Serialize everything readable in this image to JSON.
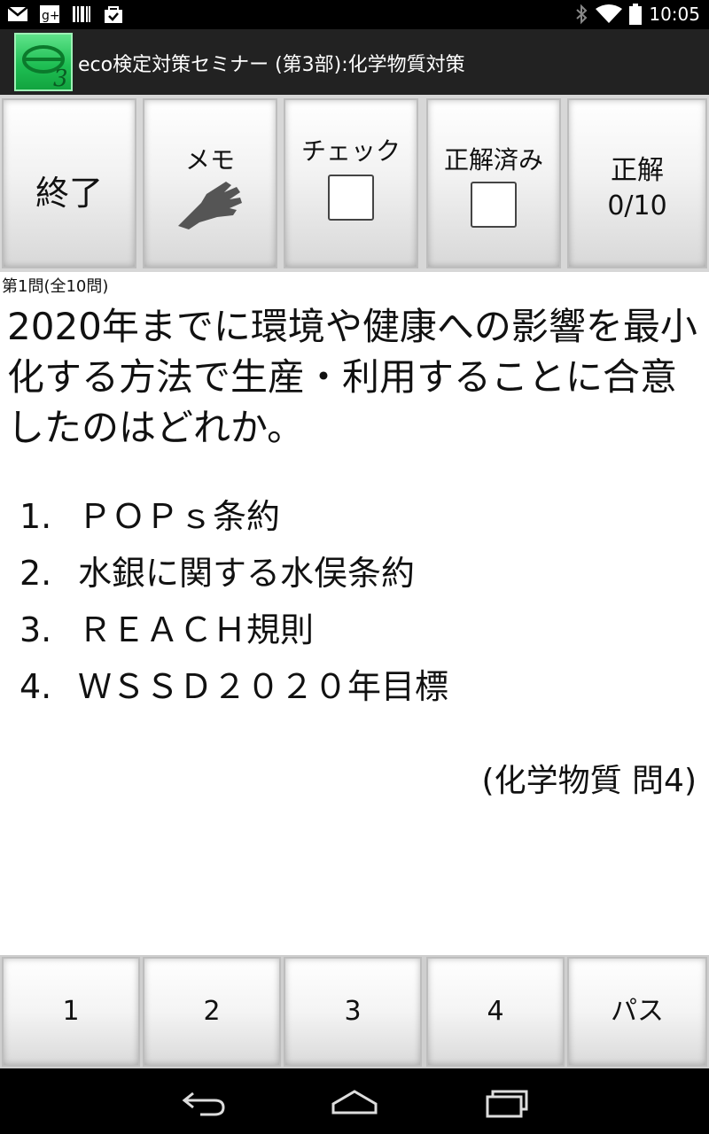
{
  "status_bar": {
    "time": "10:05",
    "left_icons": [
      "gmail-icon",
      "google-plus-icon",
      "barcode-icon",
      "shopping-bag-icon"
    ],
    "right_icons": [
      "bluetooth-icon",
      "wifi-icon",
      "battery-icon"
    ]
  },
  "app": {
    "title": "eco検定対策セミナー (第3部):化学物質対策",
    "icon_digit": "3"
  },
  "toolbar": {
    "end_label": "終了",
    "memo_label": "メモ",
    "check_label": "チェック",
    "answered_label": "正解済み",
    "correct_label": "正解",
    "correct_count": "0/10"
  },
  "question": {
    "number": "第1問(全10問)",
    "text": "2020年までに環境や健康への影響を最小化する方法で生産・利用することに合意したのはどれか。",
    "choices": [
      {
        "num": "1.",
        "text": "ＰＯＰｓ条約"
      },
      {
        "num": "2.",
        "text": "水銀に関する水俣条約"
      },
      {
        "num": "3.",
        "text": "ＲＥＡＣＨ規則"
      },
      {
        "num": "4.",
        "text": "ＷＳＳＤ２０２０年目標"
      }
    ],
    "source": "(化学物質 問4)"
  },
  "answer_buttons": [
    "1",
    "2",
    "3",
    "4",
    "パス"
  ],
  "colors": {
    "accent_green": "#1fbf54",
    "title_bar": "#222222",
    "status_bar": "#000000"
  }
}
